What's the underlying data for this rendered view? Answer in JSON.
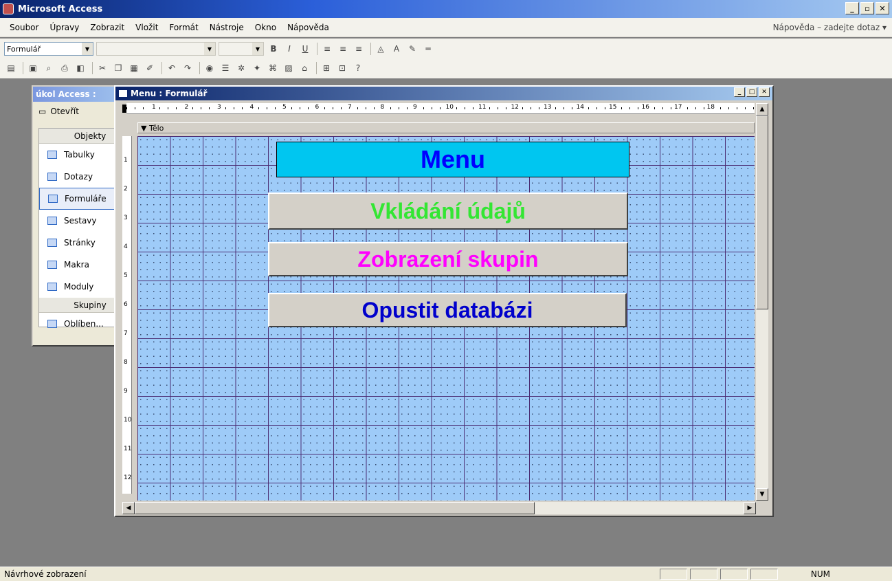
{
  "app": {
    "title": "Microsoft Access",
    "controls": [
      "_",
      "▫",
      "✕"
    ]
  },
  "menu": {
    "items": [
      "Soubor",
      "Úpravy",
      "Zobrazit",
      "Vložit",
      "Formát",
      "Nástroje",
      "Okno",
      "Nápověda"
    ],
    "help_placeholder": "Nápověda – zadejte dotaz"
  },
  "toolbar_format": {
    "object_combo": "Formulář",
    "font_combo": "",
    "size_combo": "",
    "buttons": [
      "B",
      "I",
      "U"
    ]
  },
  "db_window": {
    "title": "úkol Access :",
    "open_label": "Otevřít",
    "objects_header": "Objekty",
    "objects": [
      "Tabulky",
      "Dotazy",
      "Formuláře",
      "Sestavy",
      "Stránky",
      "Makra",
      "Moduly"
    ],
    "selected_index": 2,
    "groups_header": "Skupiny",
    "groups": [
      "Oblíben..."
    ]
  },
  "form_window": {
    "title": "Menu : Formulář",
    "section": "Tělo",
    "ruler_top": [
      "1",
      "2",
      "3",
      "4",
      "5",
      "6",
      "7",
      "8",
      "9",
      "10",
      "11",
      "12",
      "13",
      "14",
      "15",
      "16",
      "17",
      "18"
    ],
    "ruler_left": [
      "1",
      "2",
      "3",
      "4",
      "5",
      "6",
      "7",
      "8",
      "9",
      "10",
      "11",
      "12"
    ]
  },
  "controls": {
    "menu_label": {
      "text": "Menu",
      "color": "#0000ff",
      "background": "#00c6f0"
    },
    "btn_vkladani": {
      "text": "Vkládání údajů",
      "color": "#33e633"
    },
    "btn_zobrazeni": {
      "text": "Zobrazení skupin",
      "color": "#ff00ff"
    },
    "btn_opustit": {
      "text": "Opustit databázi",
      "color": "#0000cc"
    }
  },
  "status": {
    "left": "Návrhové zobrazení",
    "num": "NUM"
  }
}
